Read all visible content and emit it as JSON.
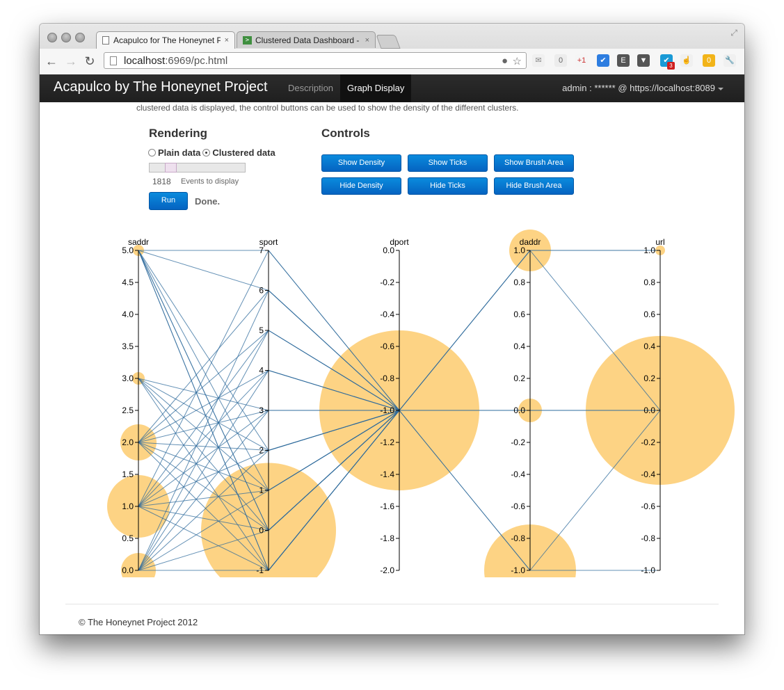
{
  "browser": {
    "tabs": [
      {
        "title": "Acapulco for The Honeynet P",
        "close": "×"
      },
      {
        "title": "Clustered Data Dashboard -",
        "close": "×"
      }
    ],
    "url_host": "localhost",
    "url_rest": ":6969/pc.html",
    "extensions": [
      {
        "name": "mail-icon",
        "label": "✉"
      },
      {
        "name": "zero-badge-icon",
        "label": "0"
      },
      {
        "name": "google-plus-one-icon",
        "label": "+1"
      },
      {
        "name": "checkmark-icon",
        "label": "✔"
      },
      {
        "name": "evernote-icon",
        "label": "E"
      },
      {
        "name": "pocket-icon",
        "label": "▼"
      },
      {
        "name": "mail-count-icon",
        "label": "✔",
        "badge": "3"
      },
      {
        "name": "hand-icon",
        "label": "☝"
      },
      {
        "name": "zero-count-icon",
        "label": "0"
      },
      {
        "name": "wrench-icon",
        "label": "🔧"
      }
    ]
  },
  "navbar": {
    "brand": "Acapulco by The Honeynet Project",
    "items": [
      "Description",
      "Graph Display"
    ],
    "user": "admin : ****** @ https://localhost:8089"
  },
  "intro": "clustered data is displayed, the control buttons can be used to show the density of the different clusters.",
  "rendering": {
    "title": "Rendering",
    "options": [
      "Plain data",
      "Clustered data"
    ],
    "selected": "Clustered data",
    "events_count": "1818",
    "events_label": "Events to display",
    "run_label": "Run",
    "status": "Done."
  },
  "controls": {
    "title": "Controls",
    "buttons": [
      "Show Density",
      "Show Ticks",
      "Show Brush Area",
      "Hide Density",
      "Hide Ticks",
      "Hide Brush Area"
    ]
  },
  "footer": "© The Honeynet Project 2012",
  "chart_data": {
    "type": "parallel-coordinates",
    "colors": {
      "line": "#2f6b9c",
      "cluster": "#fdd17d"
    },
    "axes": [
      {
        "name": "saddr",
        "range": [
          0,
          5
        ],
        "ticks": [
          "5.0",
          "4.5",
          "4.0",
          "3.5",
          "3.0",
          "2.5",
          "2.0",
          "1.5",
          "1.0",
          "0.5",
          "0.0"
        ]
      },
      {
        "name": "sport",
        "range": [
          -1,
          7
        ],
        "ticks": [
          "7",
          "6",
          "5",
          "4",
          "3",
          "2",
          "1",
          "0",
          "-1"
        ]
      },
      {
        "name": "dport",
        "range": [
          -2,
          0
        ],
        "ticks": [
          "0.0",
          "-0.2",
          "-0.4",
          "-0.6",
          "-0.8",
          "-1.0",
          "-1.2",
          "-1.4",
          "-1.6",
          "-1.8",
          "-2.0"
        ]
      },
      {
        "name": "daddr",
        "range": [
          -1,
          1
        ],
        "ticks": [
          "1.0",
          "0.8",
          "0.6",
          "0.4",
          "0.2",
          "0.0",
          "-0.2",
          "-0.4",
          "-0.6",
          "-0.8",
          "-1.0"
        ]
      },
      {
        "name": "url",
        "range": [
          -1,
          1
        ],
        "ticks": [
          "1.0",
          "0.8",
          "0.6",
          "0.4",
          "0.2",
          "0.0",
          "-0.2",
          "-0.4",
          "-0.6",
          "-0.8",
          "-1.0"
        ]
      }
    ],
    "clusters": [
      {
        "axis": "saddr",
        "value": 5.0,
        "size": 8
      },
      {
        "axis": "saddr",
        "value": 3.0,
        "size": 9
      },
      {
        "axis": "saddr",
        "value": 2.0,
        "size": 26
      },
      {
        "axis": "saddr",
        "value": 1.0,
        "size": 45
      },
      {
        "axis": "saddr",
        "value": 0.0,
        "size": 25
      },
      {
        "axis": "sport",
        "value": 0,
        "size": 97
      },
      {
        "axis": "dport",
        "value": -1.0,
        "size": 115
      },
      {
        "axis": "daddr",
        "value": 1.0,
        "size": 30
      },
      {
        "axis": "daddr",
        "value": 0.0,
        "size": 17
      },
      {
        "axis": "daddr",
        "value": -1.0,
        "size": 66
      },
      {
        "axis": "url",
        "value": 1.0,
        "size": 7
      },
      {
        "axis": "url",
        "value": 0.0,
        "size": 107
      }
    ],
    "records": [
      [
        5,
        7,
        -1,
        1,
        1
      ],
      [
        5,
        6,
        -1,
        1,
        1
      ],
      [
        5,
        2,
        -1,
        0,
        0
      ],
      [
        5,
        1,
        -1,
        0,
        0
      ],
      [
        5,
        0,
        -1,
        -1,
        -1
      ],
      [
        5,
        0,
        -1,
        -1,
        0
      ],
      [
        5,
        -1,
        -1,
        1,
        0
      ],
      [
        5,
        -1,
        -1,
        0,
        0
      ],
      [
        3,
        1,
        -1,
        0,
        0
      ],
      [
        3,
        2,
        -1,
        0,
        0
      ],
      [
        3,
        0,
        -1,
        0,
        0
      ],
      [
        3,
        -1,
        -1,
        0,
        0
      ],
      [
        3,
        3,
        -1,
        0,
        0
      ],
      [
        2,
        5,
        -1,
        0,
        0
      ],
      [
        2,
        4,
        -1,
        0,
        0
      ],
      [
        2,
        3,
        -1,
        0,
        0
      ],
      [
        2,
        2,
        -1,
        0,
        0
      ],
      [
        2,
        1,
        -1,
        0,
        0
      ],
      [
        2,
        0,
        -1,
        0,
        0
      ],
      [
        2,
        -1,
        -1,
        0,
        0
      ],
      [
        2,
        6,
        -1,
        0,
        0
      ],
      [
        1,
        7,
        -1,
        0,
        0
      ],
      [
        1,
        5,
        -1,
        0,
        0
      ],
      [
        1,
        4,
        -1,
        0,
        0
      ],
      [
        1,
        3,
        -1,
        0,
        0
      ],
      [
        1,
        2,
        -1,
        0,
        0
      ],
      [
        1,
        1,
        -1,
        0,
        0
      ],
      [
        1,
        0,
        -1,
        0,
        0
      ],
      [
        1,
        -1,
        -1,
        0,
        0
      ],
      [
        0,
        6,
        -1,
        0,
        0
      ],
      [
        0,
        5,
        -1,
        0,
        0
      ],
      [
        0,
        4,
        -1,
        0,
        0
      ],
      [
        0,
        3,
        -1,
        0,
        0
      ],
      [
        0,
        2,
        -1,
        0,
        0
      ],
      [
        0,
        1,
        -1,
        0,
        0
      ],
      [
        0,
        0,
        -1,
        0,
        0
      ],
      [
        0,
        -1,
        -1,
        0,
        0
      ]
    ]
  }
}
